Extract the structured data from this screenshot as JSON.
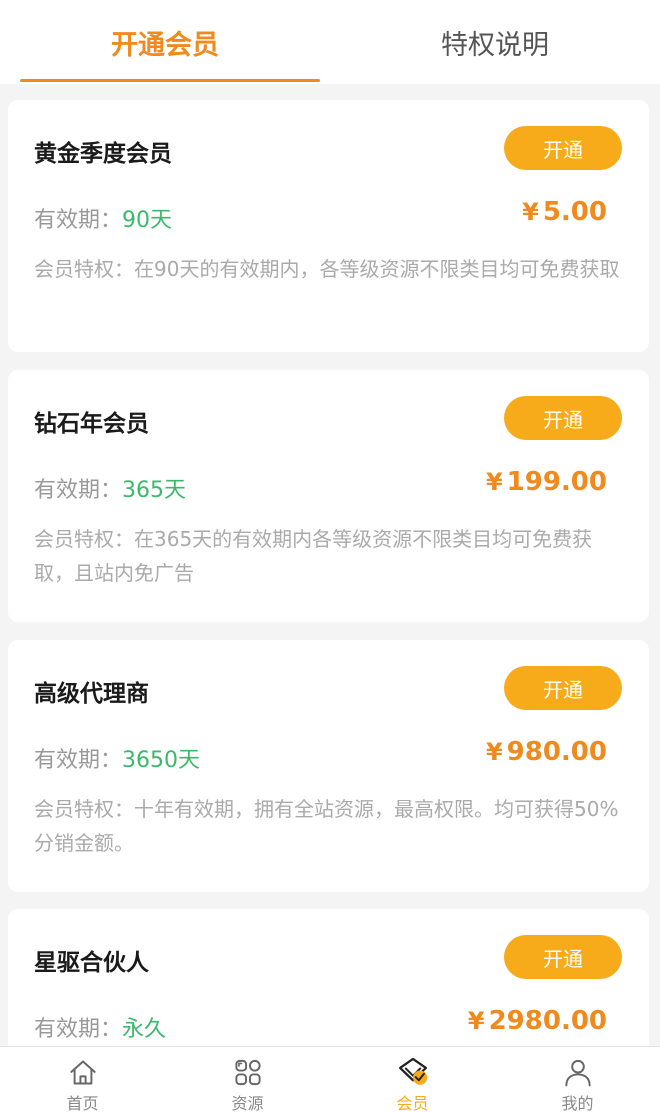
{
  "tabs": [
    {
      "label": "开通会员",
      "active": true
    },
    {
      "label": "特权说明",
      "active": false
    }
  ],
  "plans": [
    {
      "title": "黄金季度会员",
      "button": "开通",
      "validity_label": "有效期：",
      "validity_value": "90天",
      "currency": "¥",
      "price": "5.00",
      "desc": "会员特权：在90天的有效期内，各等级资源不限类目均可免费获取"
    },
    {
      "title": "钻石年会员",
      "button": "开通",
      "validity_label": "有效期：",
      "validity_value": "365天",
      "currency": "¥",
      "price": "199.00",
      "desc": "会员特权：在365天的有效期内各等级资源不限类目均可免费获取，且站内免广告"
    },
    {
      "title": "高级代理商",
      "button": "开通",
      "validity_label": "有效期：",
      "validity_value": "3650天",
      "currency": "¥",
      "price": "980.00",
      "desc": "会员特权：十年有效期，拥有全站资源，最高权限。均可获得50%分销金额。"
    },
    {
      "title": "星驱合伙人",
      "button": "开通",
      "validity_label": "有效期：",
      "validity_value": "永久",
      "currency": "¥",
      "price": "2980.00",
      "desc": ""
    }
  ],
  "nav": [
    {
      "label": "首页",
      "icon": "home-icon"
    },
    {
      "label": "资源",
      "icon": "grid-icon"
    },
    {
      "label": "会员",
      "icon": "vip-diamond-icon",
      "active": true
    },
    {
      "label": "我的",
      "icon": "user-icon"
    }
  ],
  "colors": {
    "accent": "#f08a1c",
    "button": "#f7ab1a",
    "validity": "#3bb96a"
  }
}
